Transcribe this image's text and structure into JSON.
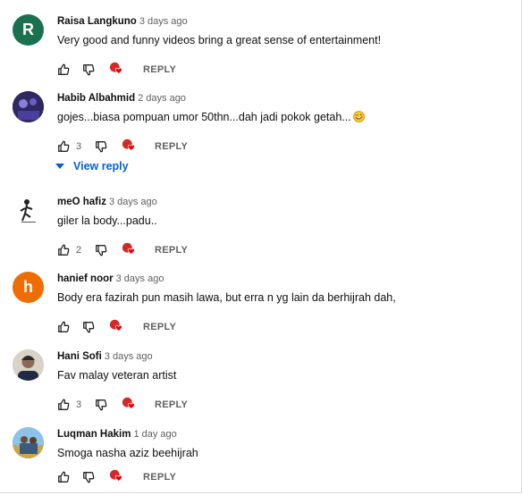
{
  "reply_label": "REPLY",
  "comments": [
    {
      "author": "Raisa Langkuno",
      "time": "3 days ago",
      "text": "Very good and funny videos bring a great sense of entertainment!",
      "likes": "",
      "avatar_letter": "R",
      "avatar_color": "#1a7150"
    },
    {
      "author": "Habib Albahmid",
      "time": "2 days ago",
      "text": "gojes...biasa pompuan umor 50thn...dah jadi pokok getah...",
      "likes": "3",
      "view_reply": "View reply"
    },
    {
      "author": "meO hafiz",
      "time": "3 days ago",
      "text": "giler la body...padu..",
      "likes": "2"
    },
    {
      "author": "hanief noor",
      "time": "3 days ago",
      "text": "Body era fazirah pun masih lawa, but erra n yg lain da berhijrah dah,",
      "likes": "",
      "avatar_letter": "h",
      "avatar_color": "#ef6c00"
    },
    {
      "author": "Hani Sofi",
      "time": "3 days ago",
      "text": "Fav malay veteran artist",
      "likes": "3"
    },
    {
      "author": "Luqman Hakim",
      "time": "1 day ago",
      "text": "Smoga nasha aziz beehijrah",
      "likes": ""
    }
  ]
}
